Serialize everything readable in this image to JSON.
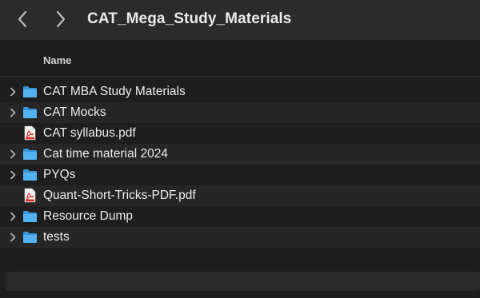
{
  "window": {
    "title": "CAT_Mega_Study_Materials"
  },
  "header": {
    "name_column": "Name"
  },
  "items": [
    {
      "label": "CAT MBA Study Materials",
      "kind": "folder"
    },
    {
      "label": "CAT Mocks",
      "kind": "folder"
    },
    {
      "label": "CAT syllabus.pdf",
      "kind": "pdf"
    },
    {
      "label": "Cat time material 2024",
      "kind": "folder"
    },
    {
      "label": "PYQs",
      "kind": "folder"
    },
    {
      "label": "Quant-Short-Tricks-PDF.pdf",
      "kind": "pdf"
    },
    {
      "label": "Resource Dump",
      "kind": "folder"
    },
    {
      "label": "tests",
      "kind": "folder"
    }
  ],
  "colors": {
    "folder": "#4aa8e8",
    "pdf": "#d8352a",
    "background": "#1e1e1e",
    "titlebar": "#2b2b2b"
  }
}
